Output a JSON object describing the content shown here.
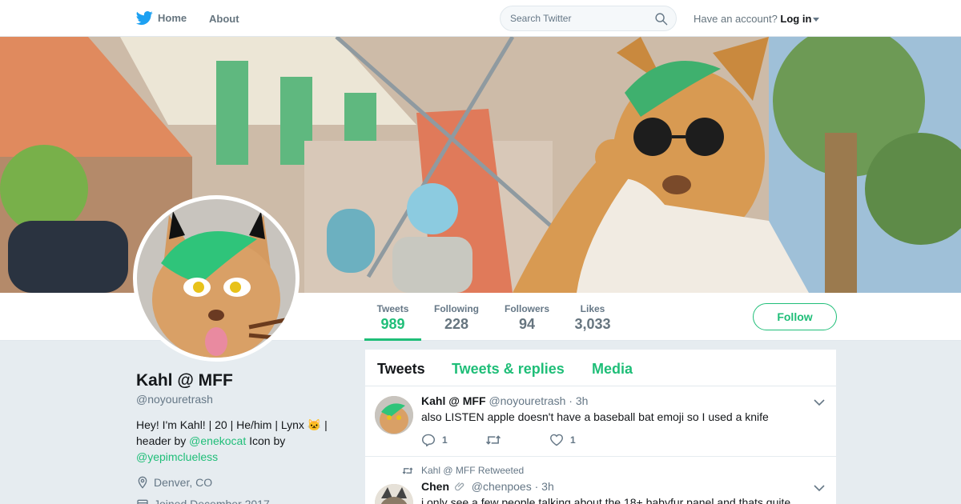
{
  "nav": {
    "home_label": "Home",
    "about_label": "About",
    "search_placeholder": "Search Twitter",
    "account_prompt": "Have an account?",
    "login_label": "Log in"
  },
  "profile": {
    "name": "Kahl @ MFF",
    "handle": "@noyouretrash",
    "bio_text_1": "Hey! I'm Kahl! | 20 | He/him | Lynx 🐱 | header by",
    "bio_link_1": "@enekocat",
    "bio_text_2": "Icon by",
    "bio_link_2": "@yepimclueless",
    "location": "Denver, CO",
    "joined": "Joined December 2017"
  },
  "stats": {
    "tweets_label": "Tweets",
    "tweets_value": "989",
    "following_label": "Following",
    "following_value": "228",
    "followers_label": "Followers",
    "followers_value": "94",
    "likes_label": "Likes",
    "likes_value": "3,033"
  },
  "follow_label": "Follow",
  "tabs": {
    "tweets": "Tweets",
    "replies": "Tweets & replies",
    "media": "Media"
  },
  "tweets": [
    {
      "name": "Kahl @ MFF",
      "handle": "@noyouretrash",
      "time": "· 3h",
      "text": "also LISTEN apple doesn't have a baseball bat emoji so I used a knife",
      "replies": "1",
      "retweets": "",
      "likes": "1"
    },
    {
      "retweeted_by": "Kahl @ MFF Retweeted",
      "name": "Chen",
      "handle": "@chenpoes",
      "time": "· 3h",
      "text": "i only see a few people talking about the 18+ babyfur panel and thats quite"
    }
  ],
  "colors": {
    "accent": "#1fbe78",
    "twitter_blue": "#1da1f2"
  }
}
